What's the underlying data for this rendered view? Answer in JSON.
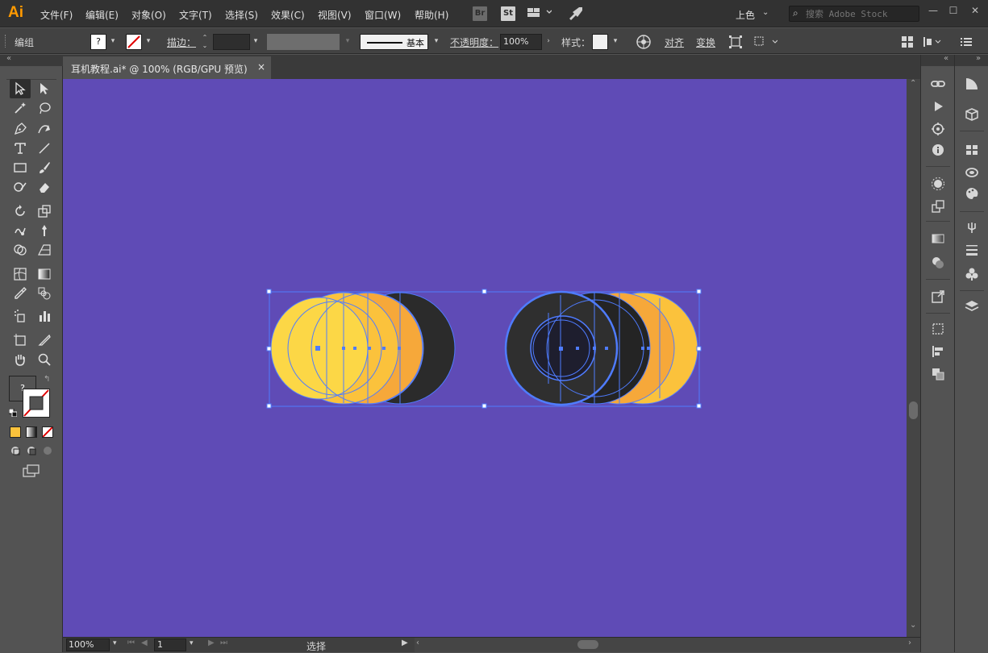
{
  "app": {
    "logo": "Ai"
  },
  "menu": {
    "items": [
      "文件(F)",
      "编辑(E)",
      "对象(O)",
      "文字(T)",
      "选择(S)",
      "效果(C)",
      "视图(V)",
      "窗口(W)",
      "帮助(H)"
    ],
    "bridge_label": "Br",
    "stock_label": "St",
    "workspace": "上色",
    "search_placeholder": "搜索 Adobe Stock"
  },
  "control": {
    "selection_label": "编组",
    "fill_label": "?",
    "stroke_label": "描边：",
    "stroke_profile": "基本",
    "opacity_label": "不透明度：",
    "opacity_value": "100%",
    "style_label": "样式：",
    "align_label": "对齐",
    "transform_label": "变换"
  },
  "document": {
    "tab_title": "耳机教程.ai* @ 100% (RGB/GPU 预览)",
    "close_glyph": "×",
    "canvas_color": "#5f4bb6"
  },
  "tools": {
    "fill_swatch_label": "?",
    "colors": {
      "fill": "#ffffff",
      "accent_yellow": "#f5c542"
    }
  },
  "status": {
    "zoom": "100%",
    "page": "1",
    "tool_status": "选择"
  },
  "artwork": {
    "colors": {
      "yellow_light": "#fcd746",
      "yellow": "#fbc23c",
      "orange": "#f6a83a",
      "dark": "#2b2b2b",
      "dark_inner": "#1e1e2e",
      "selection": "#4f7cff"
    }
  }
}
